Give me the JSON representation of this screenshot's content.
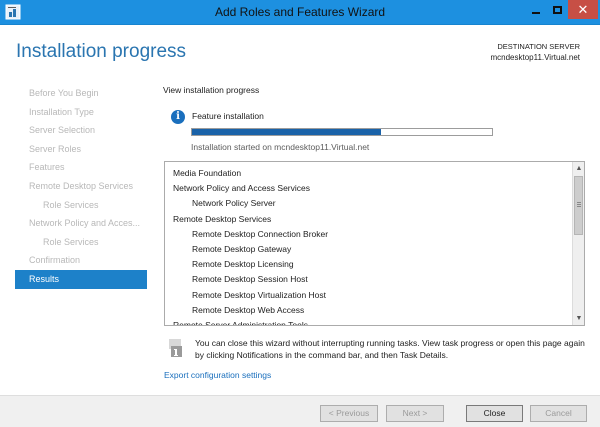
{
  "window": {
    "title": "Add Roles and Features Wizard"
  },
  "header": {
    "page_title": "Installation progress",
    "destination_label": "DESTINATION SERVER",
    "destination_server": "mcndesktop11.Virtual.net"
  },
  "nav": {
    "items": [
      {
        "label": "Before You Begin"
      },
      {
        "label": "Installation Type"
      },
      {
        "label": "Server Selection"
      },
      {
        "label": "Server Roles"
      },
      {
        "label": "Features"
      },
      {
        "label": "Remote Desktop Services"
      },
      {
        "label": "Role Services"
      },
      {
        "label": "Network Policy and Acces..."
      },
      {
        "label": "Role Services"
      },
      {
        "label": "Confirmation"
      },
      {
        "label": "Results"
      }
    ],
    "active_index": 10
  },
  "main": {
    "section_label": "View installation progress",
    "feature_label": "Feature installation",
    "progress_fraction": 0.63,
    "started_text": "Installation started on mcndesktop11.Virtual.net",
    "list_items": [
      {
        "text": "Media Foundation",
        "level": 0
      },
      {
        "text": "Network Policy and Access Services",
        "level": 0
      },
      {
        "text": "Network Policy Server",
        "level": 1
      },
      {
        "text": "Remote Desktop Services",
        "level": 0
      },
      {
        "text": "Remote Desktop Connection Broker",
        "level": 1
      },
      {
        "text": "Remote Desktop Gateway",
        "level": 1
      },
      {
        "text": "Remote Desktop Licensing",
        "level": 1
      },
      {
        "text": "Remote Desktop Session Host",
        "level": 1
      },
      {
        "text": "Remote Desktop Virtualization Host",
        "level": 1
      },
      {
        "text": "Remote Desktop Web Access",
        "level": 1
      },
      {
        "text": "Remote Server Administration Tools",
        "level": 0
      }
    ],
    "notice_text": "You can close this wizard without interrupting running tasks. View task progress or open this page again by clicking Notifications in the command bar, and then Task Details.",
    "export_link": "Export configuration settings"
  },
  "footer": {
    "previous_label": "< Previous",
    "next_label": "Next >",
    "close_label": "Close",
    "cancel_label": "Cancel"
  },
  "colors": {
    "titlebar": "#1d90e0",
    "accent": "#1d81c9",
    "progress_fill": "#1a62a8",
    "close_button": "#c74f45"
  },
  "icons": {
    "app": "server-manager-icon",
    "info": "info-icon",
    "notice": "flag-notification-icon",
    "minimize": "minimize-icon",
    "maximize": "maximize-icon",
    "close": "close-icon"
  }
}
